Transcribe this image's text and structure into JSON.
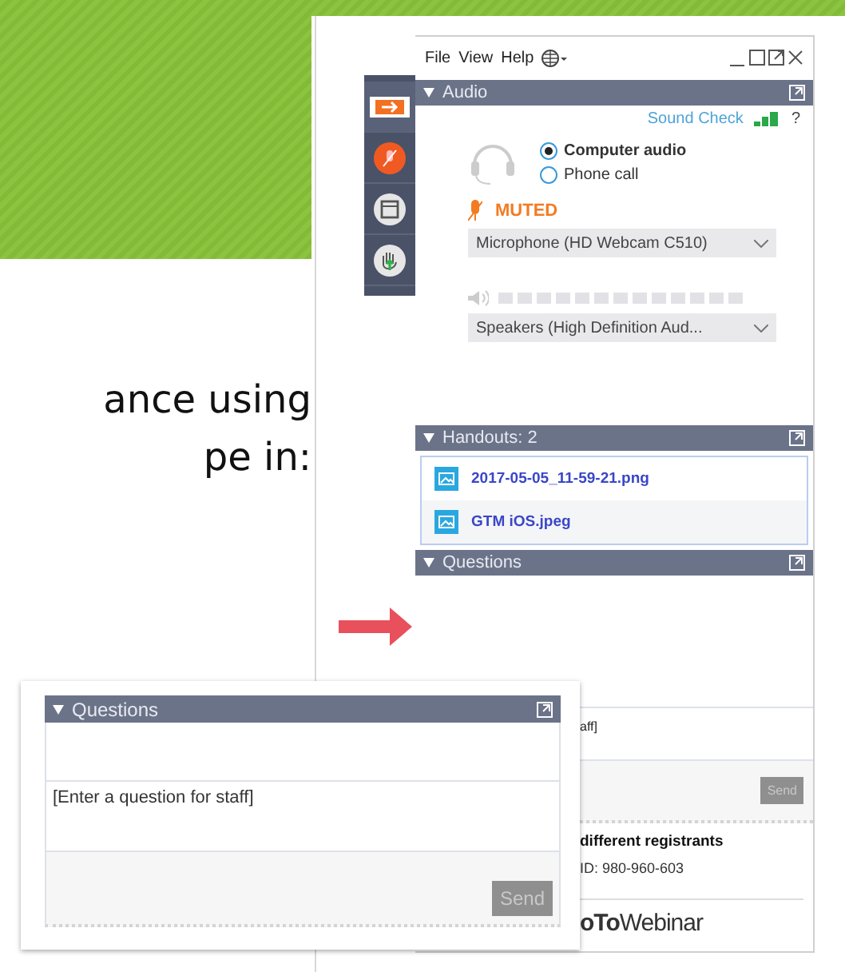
{
  "slide": {
    "text_lines": [
      "ance using",
      "pe in:"
    ]
  },
  "toolbar": [
    {
      "kind": "arrow",
      "selected": true
    },
    {
      "kind": "mic",
      "selected": false
    },
    {
      "kind": "screen",
      "selected": false
    },
    {
      "kind": "hand",
      "selected": false
    }
  ],
  "window": {
    "menu": [
      "File",
      "View",
      "Help"
    ]
  },
  "audio": {
    "title": "Audio",
    "sound_check": "Sound Check",
    "help": "?",
    "options": [
      {
        "label": "Computer audio",
        "selected": true
      },
      {
        "label": "Phone call",
        "selected": false
      }
    ],
    "mute_status": "MUTED",
    "microphone": "Microphone (HD Webcam C510)",
    "speaker_meter": {
      "level": 0
    },
    "speakers": "Speakers (High Definition Aud..."
  },
  "handouts": {
    "title": "Handouts: 2",
    "files": [
      "2017-05-05_11-59-21.png",
      "GTM iOS.jpeg"
    ]
  },
  "questions": {
    "title": "Questions",
    "input_text": "aff]",
    "send": {
      "label": "Send",
      "disabled": true
    },
    "webinar_title": "different registrants",
    "webinar_id": "ID: 980-960-603",
    "brand": "**oTo**Webinar"
  },
  "callout": {
    "title": "Questions",
    "placeholder": "[Enter a question for staff]",
    "send": {
      "label": "Send",
      "disabled": true
    }
  }
}
